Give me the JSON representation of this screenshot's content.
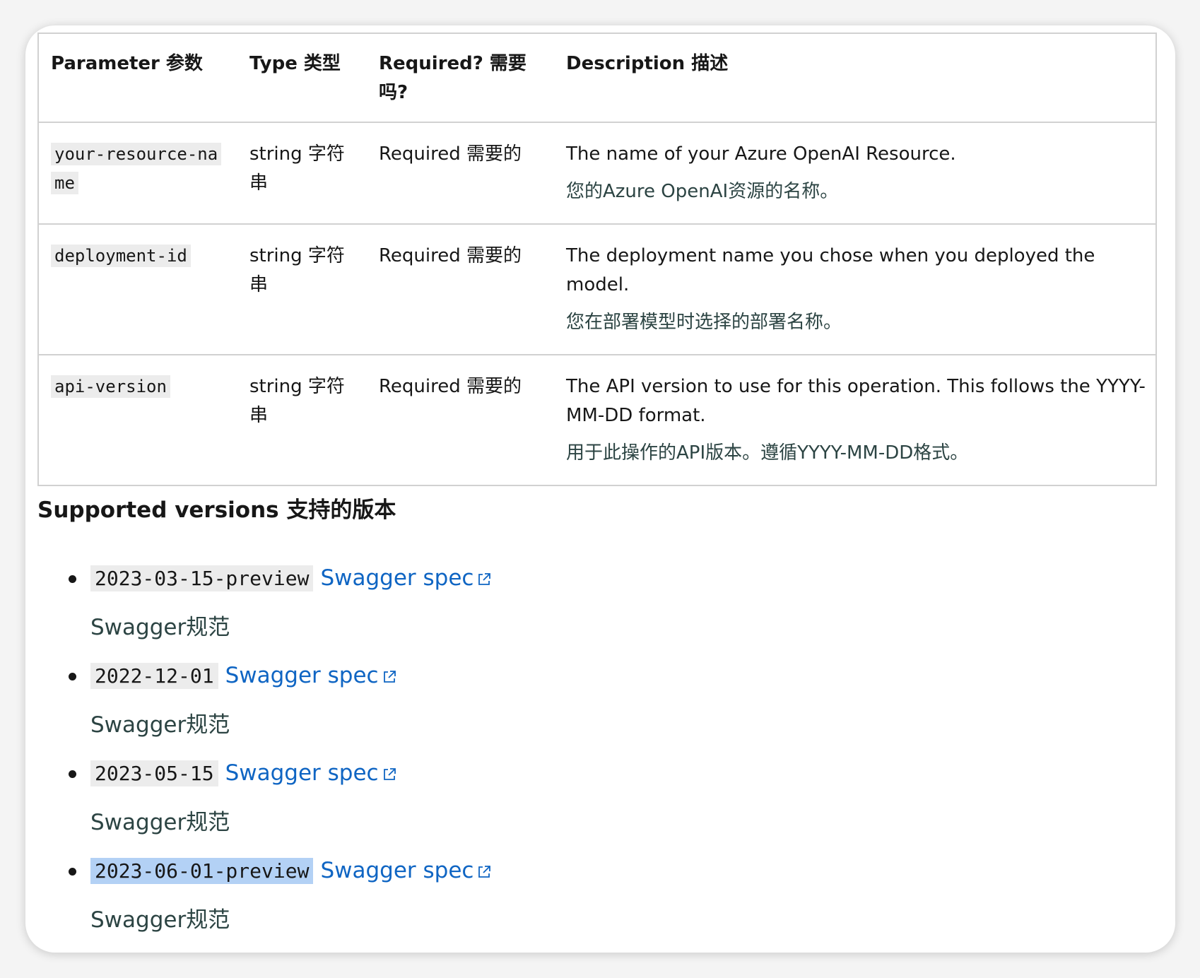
{
  "table": {
    "headers": {
      "parameter": "Parameter 参数",
      "type": "Type 类型",
      "required": "Required? 需要吗?",
      "description": "Description 描述"
    },
    "rows": [
      {
        "param": "your-resource-name",
        "type": "string 字符串",
        "required": "Required 需要的",
        "desc_en": "The name of your Azure OpenAI Resource.",
        "desc_zh": "您的Azure OpenAI资源的名称。"
      },
      {
        "param": "deployment-id",
        "type": "string 字符串",
        "required": "Required 需要的",
        "desc_en": "The deployment name you chose when you deployed the model.",
        "desc_zh": "您在部署模型时选择的部署名称。"
      },
      {
        "param": "api-version",
        "type": "string 字符串",
        "required": "Required 需要的",
        "desc_en": "The API version to use for this operation. This follows the YYYY-MM-DD format.",
        "desc_zh": "用于此操作的API版本。遵循YYYY-MM-DD格式。"
      }
    ]
  },
  "supported_versions": {
    "heading": "Supported versions 支持的版本",
    "items": [
      {
        "version": "2023-03-15-preview",
        "link": "Swagger spec",
        "zh": "Swagger规范",
        "selected": false
      },
      {
        "version": "2022-12-01",
        "link": "Swagger spec",
        "zh": "Swagger规范",
        "selected": false
      },
      {
        "version": "2023-05-15",
        "link": "Swagger spec",
        "zh": "Swagger规范",
        "selected": false
      },
      {
        "version": "2023-06-01-preview",
        "link": "Swagger spec",
        "zh": "Swagger规范",
        "selected": true
      }
    ]
  },
  "icons": {
    "external_link": "external-link-icon",
    "bullet": "bullet-icon"
  },
  "colors": {
    "link": "#0f65c3",
    "selection": "#b3d1f5",
    "code_background": "#ececec",
    "translation_text": "#2c4443"
  }
}
